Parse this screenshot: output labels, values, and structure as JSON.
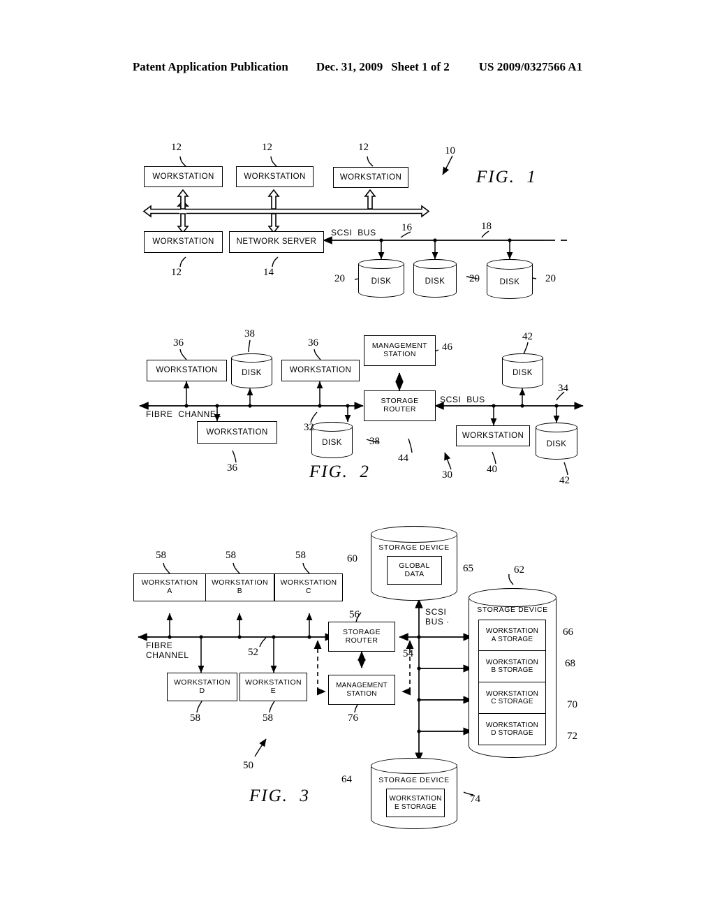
{
  "header": {
    "publication": "Patent Application Publication",
    "date": "Dec. 31, 2009",
    "sheet": "Sheet 1 of 2",
    "number": "US 2009/0327566 A1"
  },
  "figures": [
    {
      "id": "fig1",
      "label": "FIG.  1",
      "system_ref": "10",
      "boxes": [
        {
          "name": "workstation-top-1",
          "text": "WORKSTATION",
          "ref": "12"
        },
        {
          "name": "workstation-top-2",
          "text": "WORKSTATION",
          "ref": "12"
        },
        {
          "name": "workstation-top-3",
          "text": "WORKSTATION",
          "ref": "12"
        },
        {
          "name": "workstation-bottom",
          "text": "WORKSTATION",
          "ref": "12"
        },
        {
          "name": "network-server",
          "text": "NETWORK  SERVER",
          "ref": "14"
        }
      ],
      "disks": [
        {
          "text": "DISK",
          "ref": "20"
        },
        {
          "text": "DISK",
          "ref": "20"
        },
        {
          "text": "DISK",
          "ref": "20"
        }
      ],
      "bus_labels": [
        {
          "text": "SCSI  BUS",
          "ref": "16"
        },
        {
          "text": "",
          "ref": "18"
        }
      ]
    },
    {
      "id": "fig2",
      "label": "FIG.  2",
      "system_ref": "30",
      "boxes": [
        {
          "name": "workstation-a",
          "text": "WORKSTATION",
          "ref": "36"
        },
        {
          "name": "workstation-b",
          "text": "WORKSTATION",
          "ref": "36"
        },
        {
          "name": "workstation-c",
          "text": "WORKSTATION",
          "ref": "36"
        },
        {
          "name": "management-station",
          "text": "MANAGEMENT\nSTATION",
          "ref": "46"
        },
        {
          "name": "storage-router",
          "text": "STORAGE\nROUTER",
          "ref": "44"
        },
        {
          "name": "workstation-scsi",
          "text": "WORKSTATION",
          "ref": "40"
        }
      ],
      "disks": [
        {
          "text": "DISK",
          "ref": "38"
        },
        {
          "text": "DISK",
          "ref": "38"
        },
        {
          "text": "DISK",
          "ref": "42"
        },
        {
          "text": "DISK",
          "ref": "42"
        }
      ],
      "bus_labels": [
        {
          "text": "FIBRE  CHANNEL",
          "ref": "32"
        },
        {
          "text": "SCSI  BUS",
          "ref": "34"
        }
      ]
    },
    {
      "id": "fig3",
      "label": "FIG.  3",
      "system_ref": "50",
      "boxes": [
        {
          "name": "workstation-a",
          "text": "WORKSTATION\nA",
          "ref": "58"
        },
        {
          "name": "workstation-b",
          "text": "WORKSTATION\nB",
          "ref": "58"
        },
        {
          "name": "workstation-c",
          "text": "WORKSTATION\nC",
          "ref": "58"
        },
        {
          "name": "workstation-d",
          "text": "WORKSTATION\nD",
          "ref": "58"
        },
        {
          "name": "workstation-e",
          "text": "WORKSTATION\nE",
          "ref": "58"
        },
        {
          "name": "storage-router",
          "text": "STORAGE\nROUTER",
          "ref": "56"
        },
        {
          "name": "management-station",
          "text": "MANAGEMENT\nSTATION",
          "ref": "76"
        }
      ],
      "storage_devices": [
        {
          "name": "storage-device-global",
          "title": "STORAGE  DEVICE",
          "ref": "60",
          "partitions": [
            {
              "text": "GLOBAL\nDATA",
              "ref": "65"
            }
          ]
        },
        {
          "name": "storage-device-workstations",
          "title": "STORAGE  DEVICE",
          "ref": "62",
          "partitions": [
            {
              "text": "WORKSTATION\nA STORAGE",
              "ref": "66"
            },
            {
              "text": "WORKSTATION\nB STORAGE",
              "ref": "68"
            },
            {
              "text": "WORKSTATION\nC STORAGE",
              "ref": "70"
            },
            {
              "text": "WORKSTATION\nD STORAGE",
              "ref": "72"
            }
          ]
        },
        {
          "name": "storage-device-e",
          "title": "STORAGE  DEVICE",
          "ref": "64",
          "partitions": [
            {
              "text": "WORKSTATION\nE STORAGE",
              "ref": "74"
            }
          ]
        }
      ],
      "bus_labels": [
        {
          "text": "FIBRE\nCHANNEL",
          "ref": "52"
        },
        {
          "text": "SCSI\nBUS ·",
          "ref": "54"
        }
      ]
    }
  ]
}
